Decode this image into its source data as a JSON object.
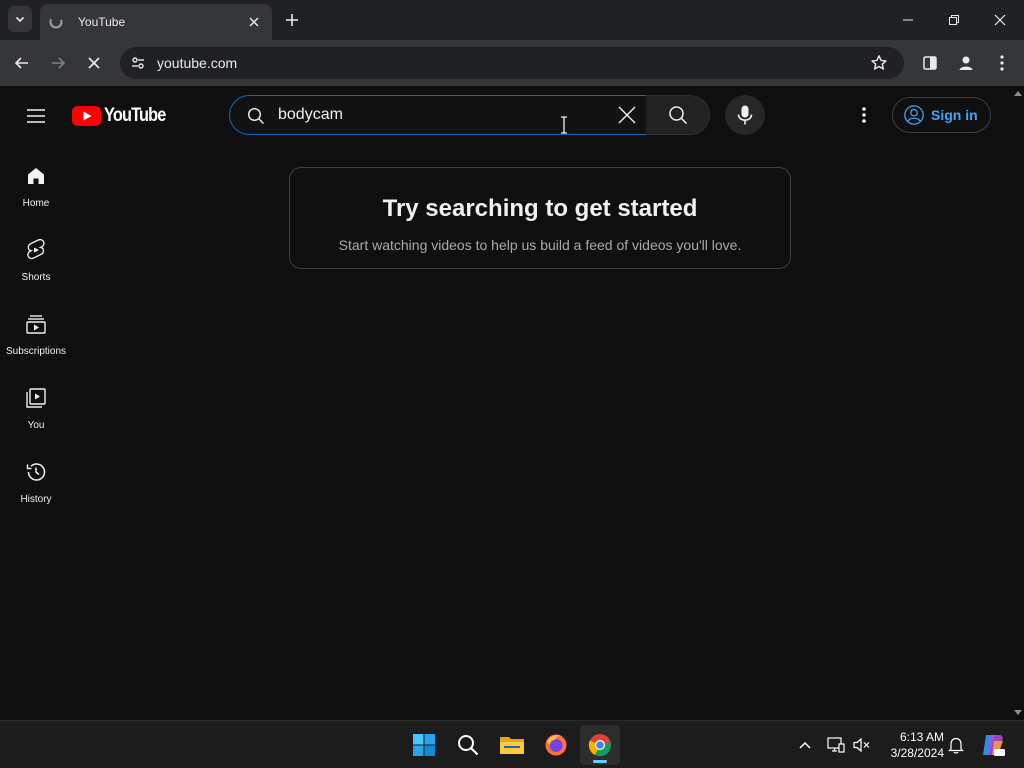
{
  "browser": {
    "tab": {
      "title": "YouTube"
    },
    "address_bar": {
      "url": "youtube.com"
    }
  },
  "youtube": {
    "logo_text": "YouTube",
    "search": {
      "query": "bodycam"
    },
    "sign_in_label": "Sign in",
    "guide": [
      {
        "label": "Home",
        "icon": "home-icon"
      },
      {
        "label": "Shorts",
        "icon": "shorts-icon"
      },
      {
        "label": "Subscriptions",
        "icon": "subscriptions-icon"
      },
      {
        "label": "You",
        "icon": "you-icon"
      },
      {
        "label": "History",
        "icon": "history-icon"
      }
    ],
    "empty_feed": {
      "title": "Try searching to get started",
      "subtitle": "Start watching videos to help us build a feed of videos you'll love."
    }
  },
  "taskbar": {
    "apps": [
      "start-icon",
      "search-icon",
      "file-explorer-icon",
      "firefox-icon",
      "chrome-icon"
    ],
    "clock": {
      "time": "6:13 AM",
      "date": "3/28/2024"
    }
  },
  "colors": {
    "yt_background": "#0f0f0f",
    "yt_red": "#ff0000",
    "link_blue": "#3ea6ff",
    "focus_border": "#1c62b9",
    "browser_dark": "#202124",
    "browser_toolbar": "#35363a",
    "taskbar": "#1c1c1c"
  }
}
